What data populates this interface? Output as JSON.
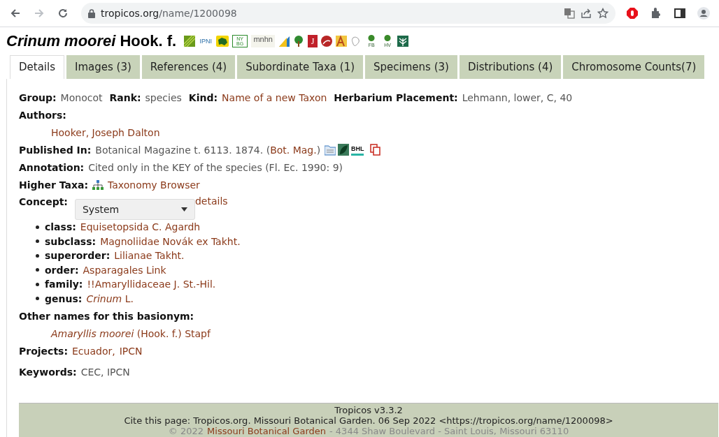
{
  "browser": {
    "host": "tropicos.org",
    "path": "/name/1200098",
    "forward_disabled": true
  },
  "title": {
    "name": "Crinum moorei",
    "author": "Hook. f."
  },
  "source_icons": [
    {
      "kind": "leaf"
    },
    {
      "kind": "text",
      "label": "IPNI"
    },
    {
      "kind": "map"
    },
    {
      "kind": "boxed",
      "label": "NY BG"
    },
    {
      "kind": "dots",
      "label": "mnhn"
    },
    {
      "kind": "fan"
    },
    {
      "kind": "tree"
    },
    {
      "kind": "boxed-red",
      "label": "J"
    },
    {
      "kind": "globe"
    },
    {
      "kind": "apni"
    },
    {
      "kind": "sketch"
    },
    {
      "kind": "sprout",
      "label": "FB"
    },
    {
      "kind": "sprout",
      "label": "HV"
    },
    {
      "kind": "plant"
    }
  ],
  "tabs": [
    {
      "label": "Details",
      "selected": true
    },
    {
      "label": "Images (3)",
      "selected": false
    },
    {
      "label": "References (4)",
      "selected": false
    },
    {
      "label": "Subordinate Taxa (1)",
      "selected": false
    },
    {
      "label": "Specimens (3)",
      "selected": false
    },
    {
      "label": "Distributions (4)",
      "selected": false
    },
    {
      "label": "Chromosome Counts(7)",
      "selected": false
    }
  ],
  "details": [
    {
      "kind": "pairs",
      "pairs": [
        {
          "label": "Group:",
          "value": "Monocot",
          "link": false
        },
        {
          "label": "Rank:",
          "value": "species",
          "link": false
        },
        {
          "label": "Kind:",
          "value": "Name of a new Taxon",
          "link": true
        },
        {
          "label": "Herbarium Placement:",
          "value": "Lehmann, lower, C, 40",
          "link": false
        }
      ]
    },
    {
      "kind": "heading",
      "label": "Authors:"
    },
    {
      "kind": "indent",
      "text": "Hooker, Joseph Dalton",
      "link": true
    },
    {
      "kind": "field",
      "label": "Published In:",
      "parts": [
        {
          "text": "Botanical Magazine t. 6113. 1874. (",
          "link": false
        },
        {
          "text": "Bot. Mag.",
          "link": true
        },
        {
          "text": ")",
          "link": false
        }
      ],
      "icons": [
        {
          "kind": "folder"
        },
        {
          "kind": "leaf"
        },
        {
          "kind": "bhl",
          "label": "BHL"
        },
        {
          "kind": "copy"
        }
      ]
    },
    {
      "kind": "field",
      "label": "Annotation:",
      "parts": [
        {
          "text": "Cited only in the KEY of the species (Fl. Ec. 1990: 9)",
          "link": false
        }
      ]
    },
    {
      "kind": "field",
      "label": "Higher Taxa:",
      "lead_icon": {
        "kind": "hierarchy"
      },
      "parts": [
        {
          "text": "Taxonomy Browser",
          "link": true
        }
      ]
    },
    {
      "kind": "concept",
      "label": "Concept:",
      "select": "System",
      "link": "details"
    },
    {
      "kind": "list",
      "items": [
        {
          "label": "class:",
          "value": "Equisetopsida C. Agardh"
        },
        {
          "label": "subclass:",
          "value": "Magnoliidae Novák ex Takht."
        },
        {
          "label": "superorder:",
          "value": "Lilianae Takht."
        },
        {
          "label": "order:",
          "value": "Asparagales Link"
        },
        {
          "label": "family:",
          "value": "!!Amaryllidaceae J. St.-Hil."
        },
        {
          "label": "genus:",
          "value": "*Crinum* L."
        }
      ]
    },
    {
      "kind": "heading",
      "label": "Other names for this basionym:"
    },
    {
      "kind": "indent",
      "text": "*Amaryllis moorei* (Hook. f.) Stapf",
      "link": true
    },
    {
      "kind": "field",
      "label": "Projects:",
      "parts": [
        {
          "text": "Ecuador,",
          "link": true
        },
        {
          "text": "IPCN",
          "link": true
        }
      ]
    },
    {
      "kind": "field",
      "label": "Keywords:",
      "parts": [
        {
          "text": "CEC, IPCN",
          "link": false
        }
      ]
    }
  ],
  "footer": {
    "version": "Tropicos v3.3.2",
    "cite": "Cite this page: Tropicos.org. Missouri Botanical Garden. 06 Sep 2022 <https://tropicos.org/name/1200098>",
    "copyright": [
      {
        "text": "© 2022",
        "link": false
      },
      {
        "text": "Missouri Botanical Garden",
        "link": true
      },
      {
        "text": "- 4344 Shaw Boulevard - Saint Louis, Missouri 63110",
        "link": false
      }
    ]
  }
}
